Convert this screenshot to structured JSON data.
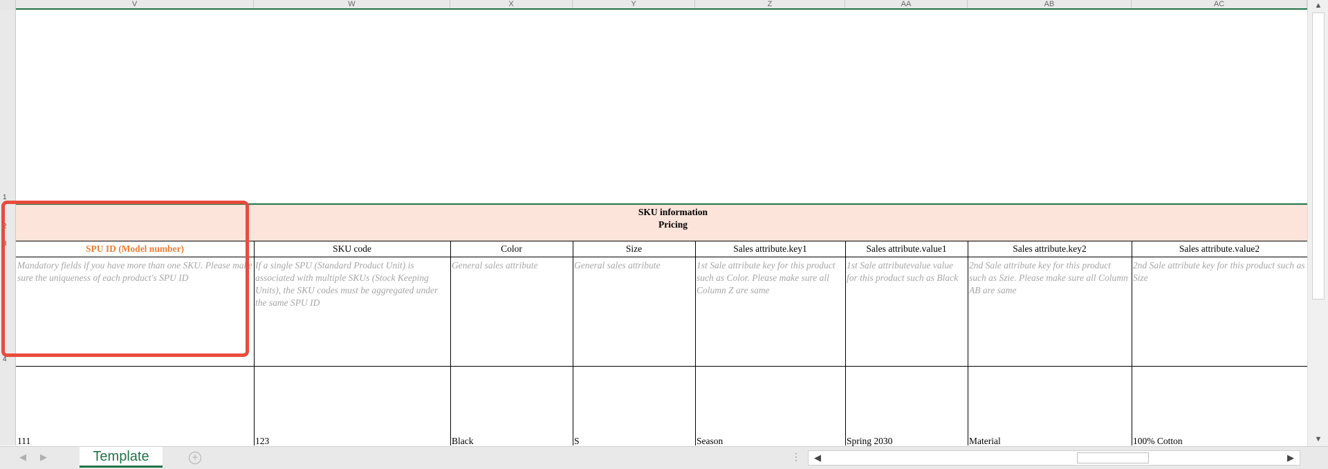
{
  "columns": [
    "V",
    "W",
    "X",
    "Y",
    "Z",
    "AA",
    "AB",
    "AC"
  ],
  "rows": [
    "1",
    "2",
    "3",
    "4"
  ],
  "section": {
    "line1": "SKU information",
    "line2": "Pricing"
  },
  "headers": {
    "V": "SPU ID (Model number)",
    "W": "SKU code",
    "X": "Color",
    "Y": "Size",
    "Z": "Sales attribute.key1",
    "AA": "Sales attribute.value1",
    "AB": "Sales attribute.key2",
    "AC": "Sales attribute.value2"
  },
  "descriptions": {
    "V": "Mandatory fields if you have more than one SKU. Please make sure the uniqueness of each product's SPU ID",
    "W": "If a single SPU (Standard Product Unit) is associated with multiple SKUs (Stock Keeping Units), the SKU codes must be aggregated under the same SPU ID",
    "X": "General sales attribute",
    "Y": "General sales attribute",
    "Z": "1st Sale attribute key for this product such as Color. Please make sure all Column Z are same",
    "AA": "1st Sale attributevalue value for this product such as Black",
    "AB": "2nd Sale attribute key for this product such as Szie. Please make sure all Column AB are same",
    "AC": "2nd Sale attribute key for this product such as Size"
  },
  "values": {
    "V": "111",
    "W": "123",
    "X": "Black",
    "Y": "S",
    "Z": "Season",
    "AA": "Spring 2030",
    "AB": "Material",
    "AC": "100% Cotton"
  },
  "sheet_tab": "Template",
  "colors": {
    "accent": "#217346",
    "header_band": "#fce4da",
    "spu_header": "#ed7d31",
    "highlight_box": "#e84c3d",
    "hint_text": "#a6a6a6"
  },
  "icons": {
    "nav_prev": "triangle-left-icon",
    "nav_next": "triangle-right-icon",
    "add_sheet": "plus-circle-icon",
    "more": "vertical-dots-icon"
  }
}
